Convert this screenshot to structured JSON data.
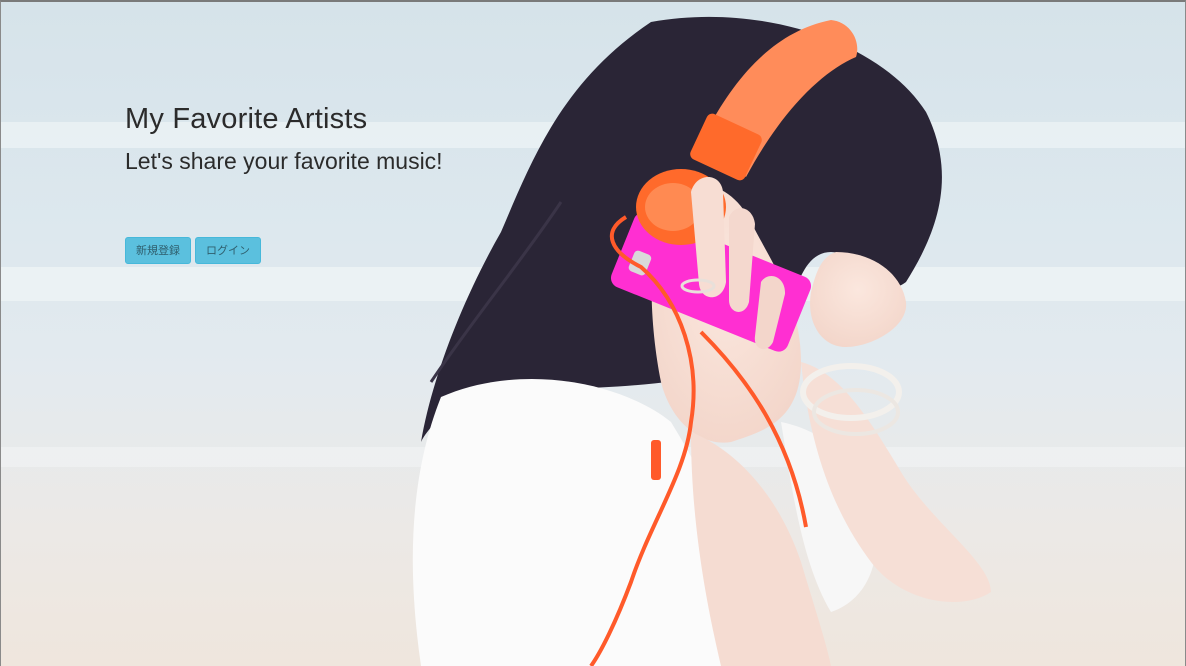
{
  "hero": {
    "title": "My Favorite Artists",
    "subtitle": "Let's share your favorite music!"
  },
  "actions": {
    "signup_label": "新規登録",
    "login_label": "ログイン"
  },
  "colors": {
    "button_bg": "#5bc0de",
    "button_border": "#46b8da",
    "headphone_orange": "#ff6a2b",
    "phone_pink": "#ff2fd2",
    "text": "#2b2b2b"
  }
}
